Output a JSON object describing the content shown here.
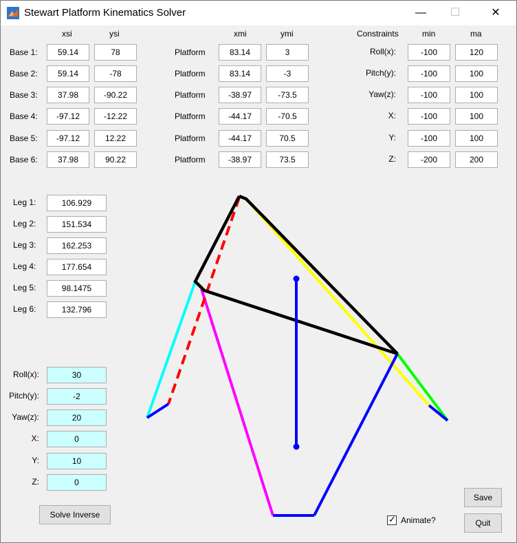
{
  "window": {
    "title": "Stewart Platform Kinematics Solver",
    "minimize": "—",
    "maximize": "☐",
    "close": "✕"
  },
  "base": {
    "col_x": "xsi",
    "col_y": "ysi",
    "rows": [
      {
        "label": "Base 1:",
        "x": "59.14",
        "y": "78"
      },
      {
        "label": "Base 2:",
        "x": "59.14",
        "y": "-78"
      },
      {
        "label": "Base 3:",
        "x": "37.98",
        "y": "-90.22"
      },
      {
        "label": "Base 4:",
        "x": "-97.12",
        "y": "-12.22"
      },
      {
        "label": "Base 5:",
        "x": "-97.12",
        "y": "12.22"
      },
      {
        "label": "Base 6:",
        "x": "37.98",
        "y": "90.22"
      }
    ]
  },
  "platform": {
    "col_x": "xmi",
    "col_y": "ymi",
    "rows": [
      {
        "label": "Platform",
        "x": "83.14",
        "y": "3"
      },
      {
        "label": "Platform",
        "x": "83.14",
        "y": "-3"
      },
      {
        "label": "Platform",
        "x": "-38.97",
        "y": "-73.5"
      },
      {
        "label": "Platform",
        "x": "-44.17",
        "y": "-70.5"
      },
      {
        "label": "Platform",
        "x": "-44.17",
        "y": "70.5"
      },
      {
        "label": "Platform",
        "x": "-38.97",
        "y": "73.5"
      }
    ]
  },
  "constraints": {
    "col_label": "Constraints",
    "col_min": "min",
    "col_max": "ma",
    "rows": [
      {
        "label": "Roll(x):",
        "min": "-100",
        "max": "120"
      },
      {
        "label": "Pitch(y):",
        "min": "-100",
        "max": "100"
      },
      {
        "label": "Yaw(z):",
        "min": "-100",
        "max": "100"
      },
      {
        "label": "X:",
        "min": "-100",
        "max": "100"
      },
      {
        "label": "Y:",
        "min": "-100",
        "max": "100"
      },
      {
        "label": "Z:",
        "min": "-200",
        "max": "200"
      }
    ]
  },
  "legs": [
    {
      "label": "Leg 1:",
      "value": "106.929"
    },
    {
      "label": "Leg 2:",
      "value": "151.534"
    },
    {
      "label": "Leg 3:",
      "value": "162.253"
    },
    {
      "label": "Leg 4:",
      "value": "177.654"
    },
    {
      "label": "Leg 5:",
      "value": "98.1475"
    },
    {
      "label": "Leg 6:",
      "value": "132.796"
    }
  ],
  "pose": [
    {
      "label": "Roll(x):",
      "value": "30"
    },
    {
      "label": "Pitch(y):",
      "value": "-2"
    },
    {
      "label": "Yaw(z):",
      "value": "20"
    },
    {
      "label": "X:",
      "value": "0"
    },
    {
      "label": "Y:",
      "value": "10"
    },
    {
      "label": "Z:",
      "value": "0"
    }
  ],
  "buttons": {
    "solve": "Solve Inverse",
    "save": "Save",
    "quit": "Quit"
  },
  "animate": {
    "label": "Animate?",
    "checked": true
  },
  "colors": {
    "platform_edge": "#000000",
    "axis": "#0000ff",
    "leg1": "#ff0000",
    "leg2": "#00ffff",
    "leg3": "#ff00ff",
    "leg4": "#0000ff",
    "leg5": "#00ff00",
    "leg6": "#ffff00",
    "base": "#0000ff",
    "pose_box": "#ccffff"
  }
}
